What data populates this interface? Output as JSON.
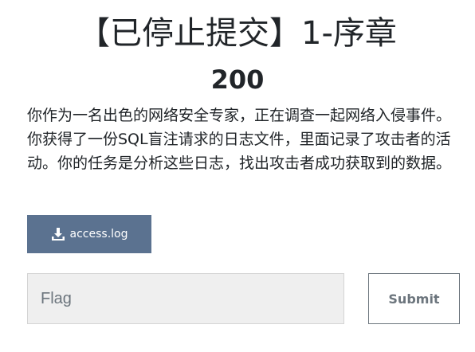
{
  "challenge": {
    "title": "【已停止提交】1-序章",
    "value": "200",
    "description": "你作为一名出色的网络安全专家，正在调查一起网络入侵事件。你获得了一份SQL盲注请求的日志文件，里面记录了攻击者的活动。你的任务是分析这些日志，找出攻击者成功获取到的数据。"
  },
  "files": {
    "download_label": "access.log",
    "icon": "download-icon"
  },
  "form": {
    "flag_placeholder": "Flag",
    "flag_value": "",
    "submit_label": "Submit"
  },
  "colors": {
    "download_button_bg": "#5b7290",
    "submit_border": "#6c757d",
    "input_bg": "#efefef"
  }
}
